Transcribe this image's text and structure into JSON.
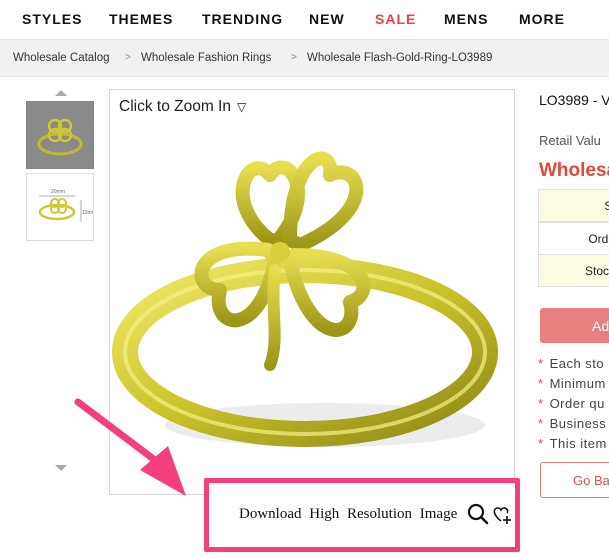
{
  "nav": {
    "items": [
      {
        "label": "STYLES"
      },
      {
        "label": "THEMES"
      },
      {
        "label": "TRENDING"
      },
      {
        "label": "NEW"
      },
      {
        "label": "SALE"
      },
      {
        "label": "MENS"
      },
      {
        "label": "MORE"
      }
    ]
  },
  "breadcrumb": {
    "items": [
      "Wholesale Catalog",
      "Wholesale Fashion Rings",
      "Wholesale Flash-Gold-Ring-LO3989"
    ],
    "separator": ">"
  },
  "gallery": {
    "zoom_label": "Click to Zoom In",
    "zoom_caret": "▽",
    "thumb_dim_width": "20mm",
    "thumb_dim_height": "12mm"
  },
  "download": {
    "label": "Download High Resolution Image"
  },
  "product": {
    "sku_title": "LO3989 - V",
    "retail_label": "Retail Valu",
    "wholesale_label": "Wholesa",
    "table_rows": [
      "Si",
      "Orde",
      "Stock"
    ],
    "add_button": "Ad",
    "notes": [
      "Each sto",
      "Minimum",
      "Order qu",
      "Business",
      "This item"
    ],
    "back_button": "Go Ba"
  },
  "colors": {
    "accent": "#e4483b",
    "highlight": "#f43f7f",
    "gold": "#c9c32a"
  }
}
